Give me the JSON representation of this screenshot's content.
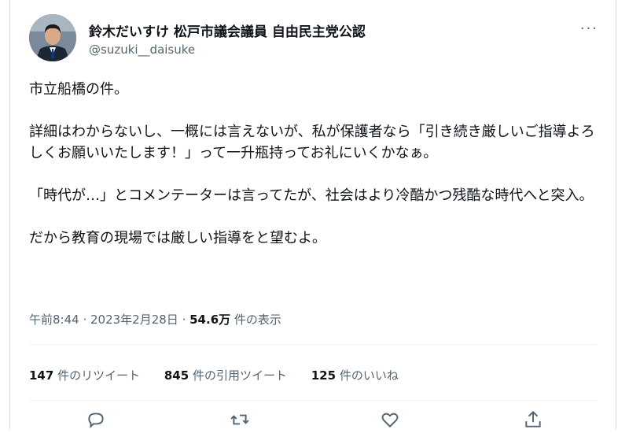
{
  "author": {
    "name": "鈴木だいすけ 松戸市議会議員 自由民主党公認",
    "handle": "@suzuki__daisuke"
  },
  "tweet": {
    "paragraphs": [
      "市立船橋の件。",
      "詳細はわからないし、一概には言えないが、私が保護者なら「引き続き厳しいご指導よろしくお願いいたします！」って一升瓶持ってお礼にいくかなぁ。",
      "「時代が…」とコメンテーターは言ってたが、社会はより冷酷かつ残酷な時代へと突入。",
      "だから教育の現場では厳しい指導をと望むよ。"
    ]
  },
  "meta": {
    "time": "午前8:44",
    "separator1": " · ",
    "date": "2023年2月28日",
    "separator2": " · ",
    "views_count": "54.6万",
    "views_label": " 件の表示"
  },
  "stats": {
    "retweets_count": "147",
    "retweets_label": " 件のリツイート",
    "quotes_count": "845",
    "quotes_label": " 件の引用ツイート",
    "likes_count": "125",
    "likes_label": " 件のいいね"
  },
  "more_label": "···",
  "icons": {
    "reply": "reply-icon",
    "retweet": "retweet-icon",
    "like": "heart-icon",
    "share": "share-icon"
  },
  "colors": {
    "text": "#0f1419",
    "secondary": "#536471",
    "border": "#cfd9de"
  }
}
